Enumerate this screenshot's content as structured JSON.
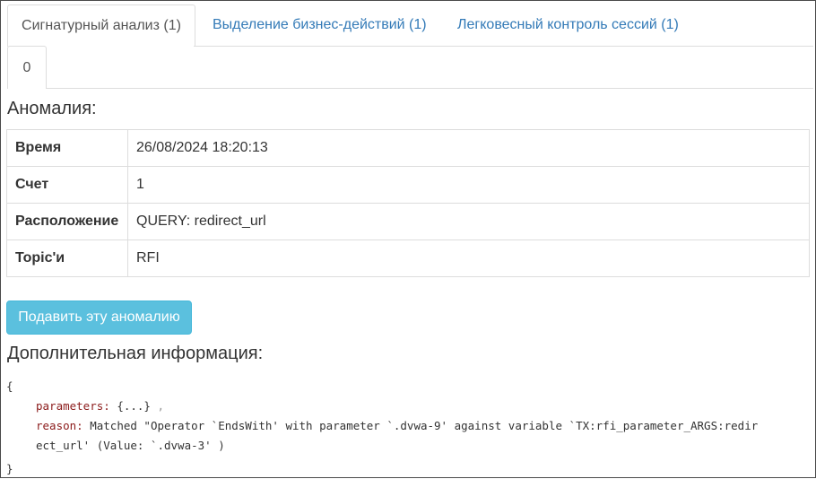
{
  "tabs": [
    {
      "label": "Сигнатурный анализ (1)",
      "active": true
    },
    {
      "label": "Выделение бизнес-действий (1)",
      "active": false
    },
    {
      "label": "Легковесный контроль сессий (1)",
      "active": false
    }
  ],
  "subtab": {
    "label": "0"
  },
  "anomaly": {
    "heading": "Аномалия:",
    "rows": [
      {
        "key": "Время",
        "value": "26/08/2024 18:20:13"
      },
      {
        "key": "Счет",
        "value": "1"
      },
      {
        "key": "Расположение",
        "value": "QUERY: redirect_url"
      },
      {
        "key": "Topic'и",
        "value": "RFI"
      }
    ]
  },
  "suppress_button": "Подавить эту аномалию",
  "extra": {
    "heading": "Дополнительная информация:",
    "open_brace": "{",
    "params_key": "parameters:",
    "params_value": "{...}",
    "params_comma": ",",
    "reason_key": "reason:",
    "reason_value_1": "Matched \"Operator `EndsWith' with parameter `.dvwa-9' against variable `TX:rfi_parameter_ARGS:redir",
    "reason_value_2": "ect_url' (Value: `.dvwa-3' )",
    "close_brace": "}"
  },
  "colors": {
    "link": "#337ab7",
    "button": "#5bc0de",
    "key": "#8b1a1a",
    "subtab": "#e05050"
  }
}
